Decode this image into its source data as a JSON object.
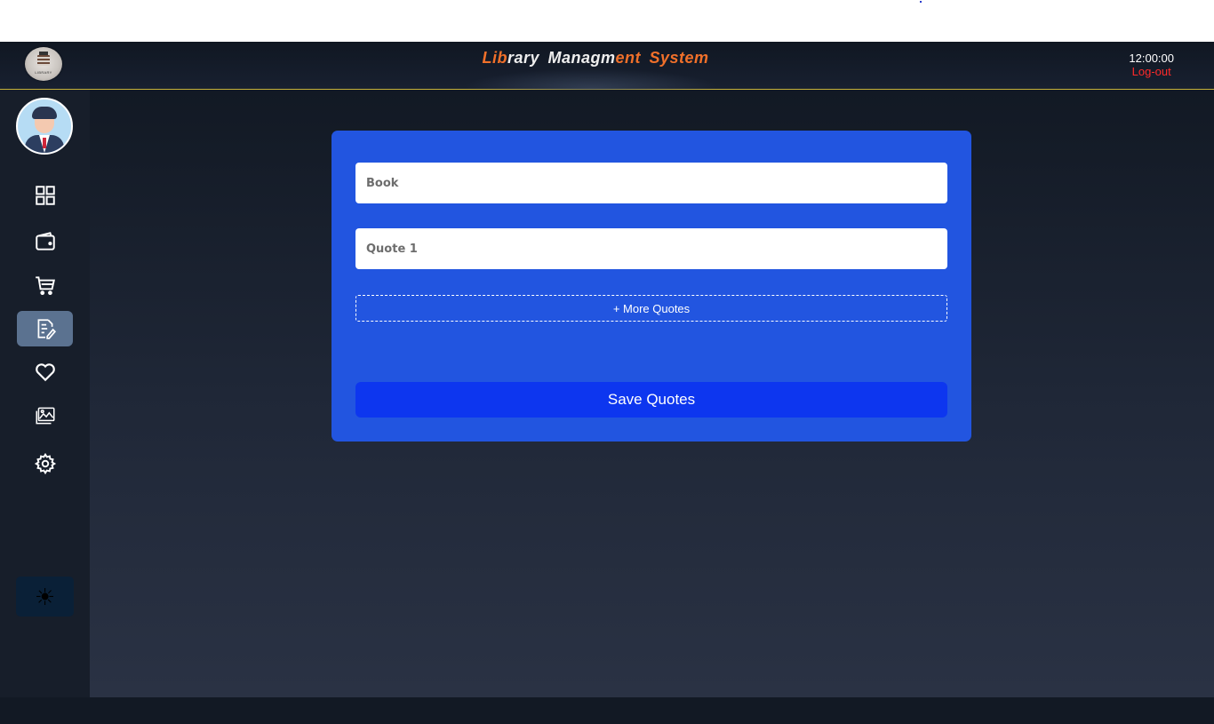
{
  "header": {
    "title_part1": "Lib",
    "title_part2": "rary  Managm",
    "title_part3": "ent  System",
    "time": "12:00:00",
    "logout_label": "Log-out",
    "logo_tag": "LIBRARY"
  },
  "sidebar": {
    "items": [
      {
        "icon": "dashboard-grid-icon",
        "active": false
      },
      {
        "icon": "wallet-icon",
        "active": false
      },
      {
        "icon": "cart-icon",
        "active": false
      },
      {
        "icon": "edit-document-icon",
        "active": true
      },
      {
        "icon": "heart-icon",
        "active": false
      },
      {
        "icon": "gallery-icon",
        "active": false
      },
      {
        "icon": "gear-icon",
        "active": false
      }
    ],
    "theme_toggle_icon": "☀"
  },
  "form": {
    "book_placeholder": "Book",
    "quote_placeholder": "Quote 1",
    "more_quotes_label": "+ More Quotes",
    "save_label": "Save Quotes"
  },
  "colors": {
    "accent": "#2255e0",
    "save_button": "#0d36ef",
    "title_orange": "#f0702a",
    "logout": "#ff2a2a",
    "active_nav": "#5b7290"
  }
}
